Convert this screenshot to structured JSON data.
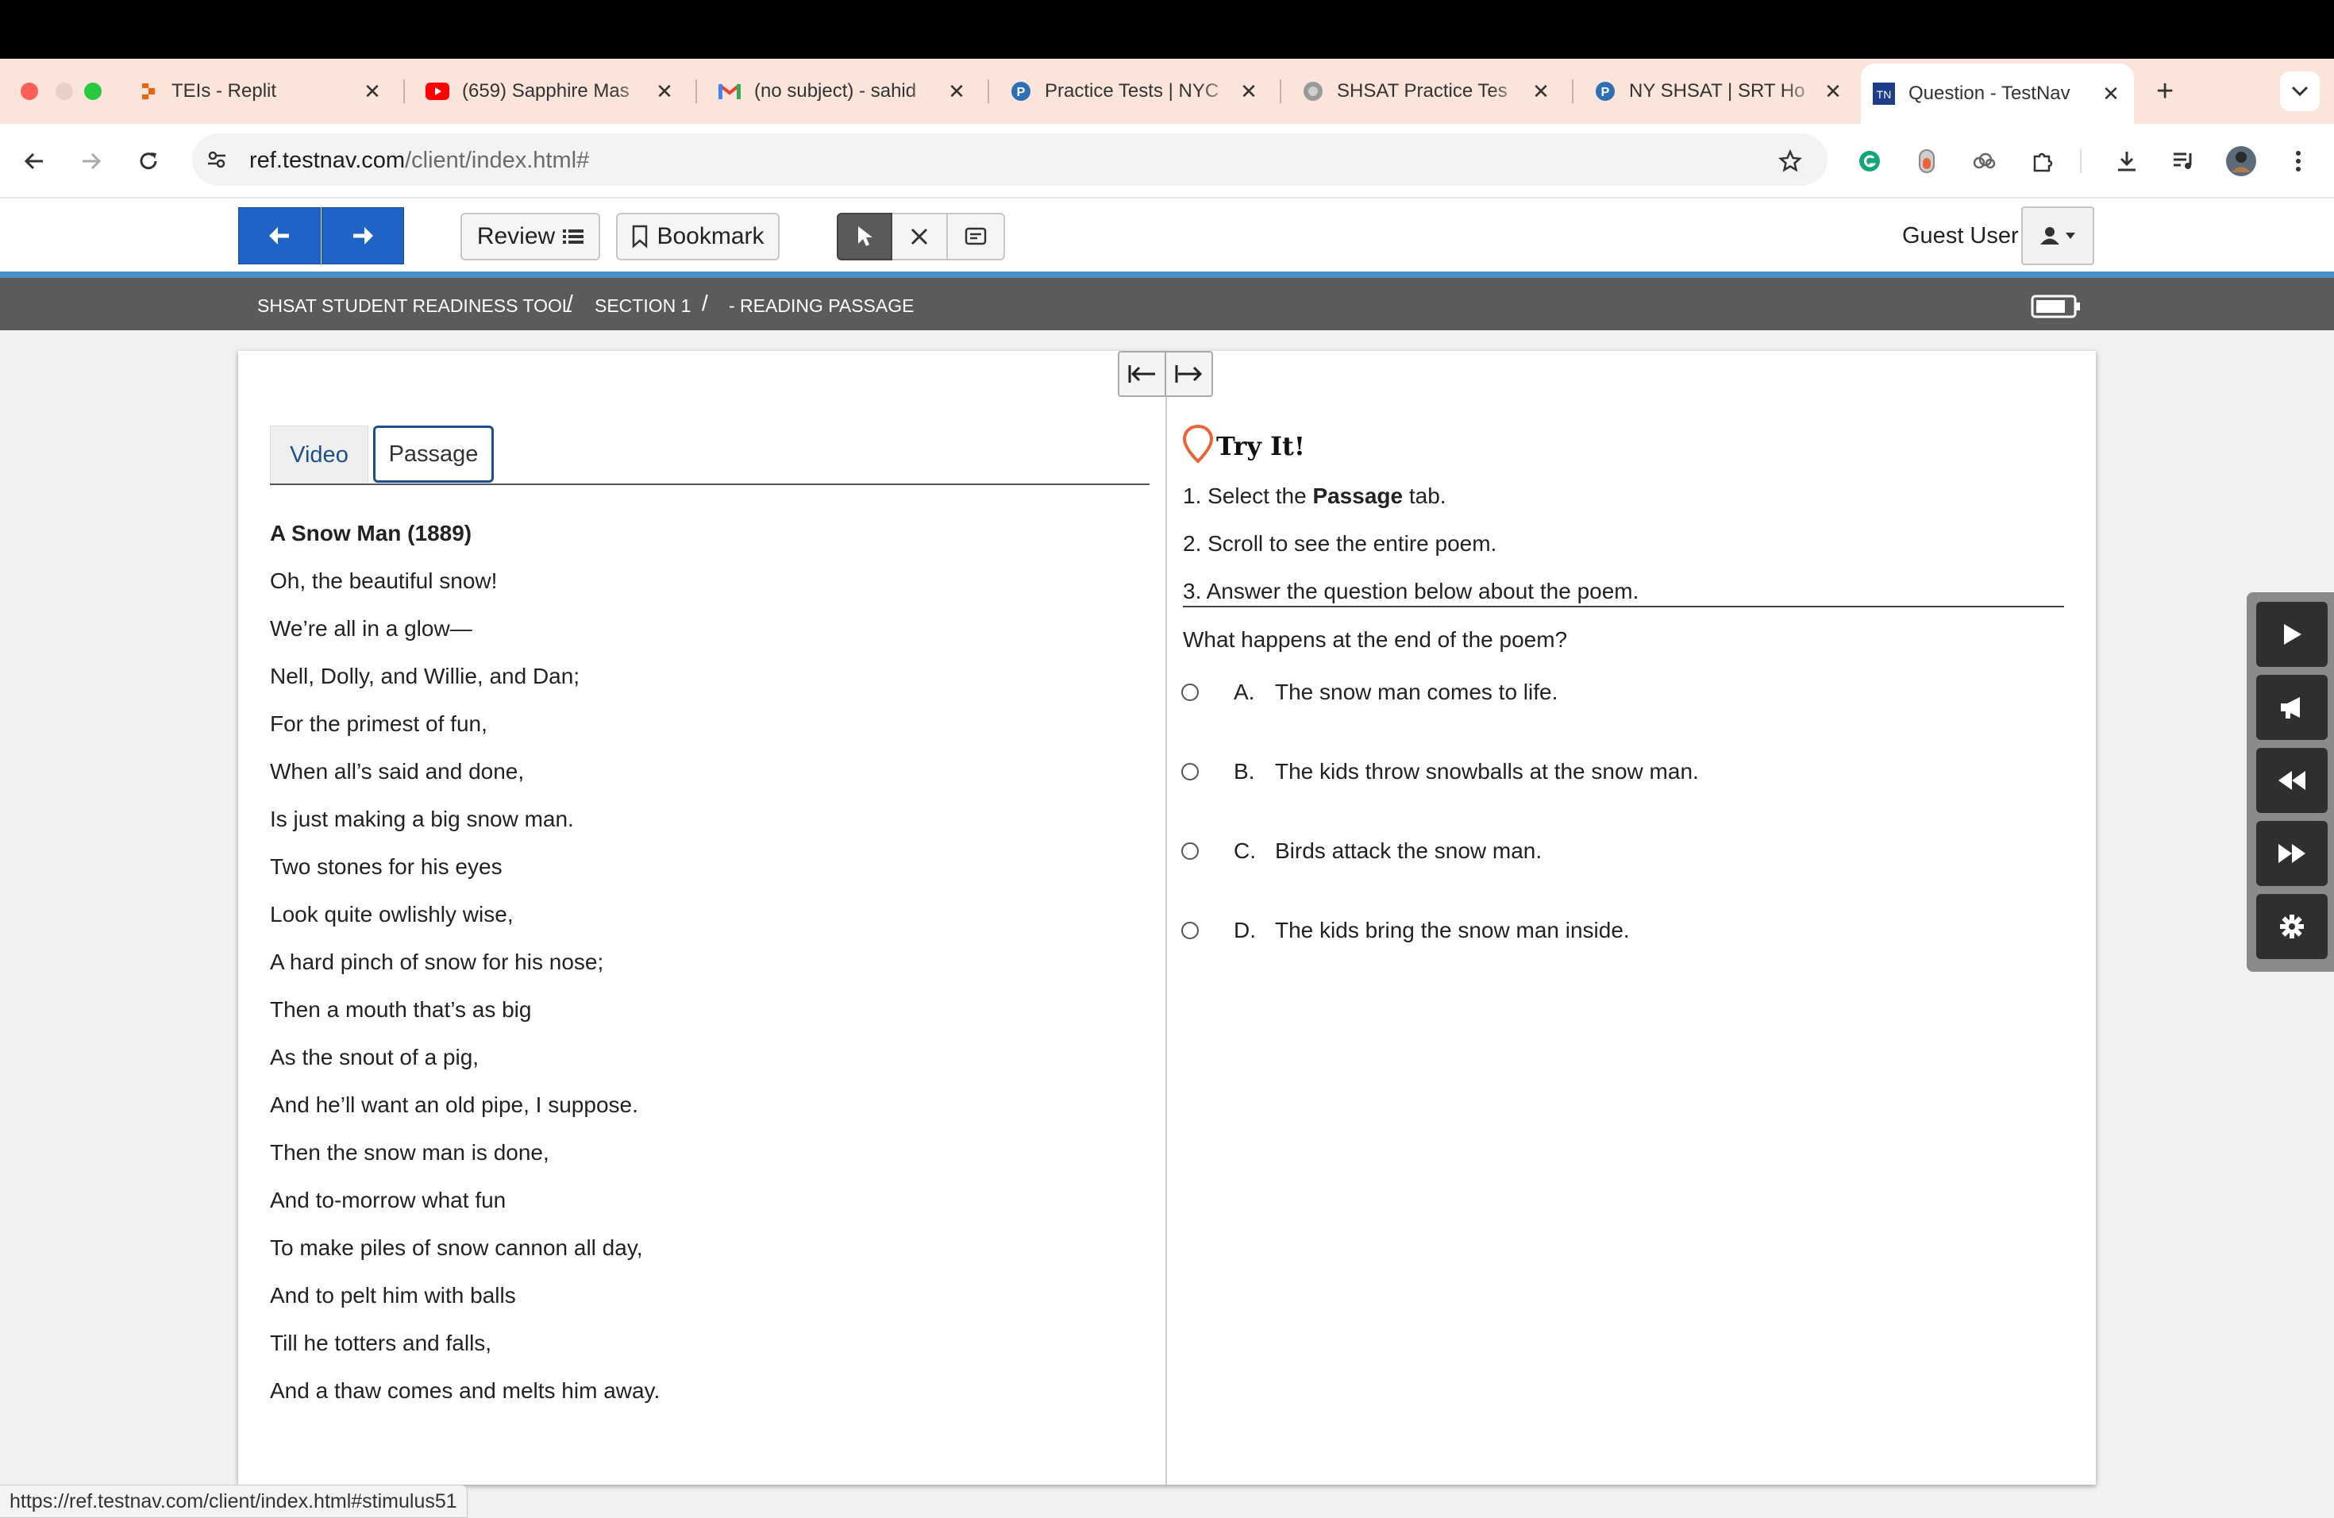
{
  "browser": {
    "tabs": [
      {
        "title": "TEIs - Replit",
        "favicon": "replit-icon",
        "active": false
      },
      {
        "title": "(659) Sapphire Mas",
        "favicon": "youtube-icon",
        "active": false
      },
      {
        "title": "(no subject) - sahid",
        "favicon": "gmail-icon",
        "active": false
      },
      {
        "title": "Practice Tests | NYC",
        "favicon": "p-circle-icon",
        "active": false
      },
      {
        "title": "SHSAT Practice Tes",
        "favicon": "globe-icon",
        "active": false
      },
      {
        "title": "NY SHSAT | SRT Ho",
        "favicon": "p-circle-icon",
        "active": false
      },
      {
        "title": "Question - TestNav",
        "favicon": "testnav-icon",
        "active": true
      }
    ],
    "new_tab_glyph": "+",
    "url_host": "ref.testnav.com",
    "url_path": "/client/index.html#",
    "status_url": "https://ref.testnav.com/client/index.html#stimulus51"
  },
  "app": {
    "review_label": "Review",
    "bookmark_label": "Bookmark",
    "guest_label": "Guest User",
    "breadcrumb": [
      "SHSAT STUDENT READINESS TOOL",
      "SECTION 1",
      "- READING PASSAGE"
    ],
    "breadcrumb_sep": "/"
  },
  "left_pane": {
    "tabs": {
      "video": "Video",
      "passage": "Passage"
    },
    "poem_title": "A Snow Man (1889)",
    "poem_lines": [
      "Oh, the beautiful snow!",
      "We’re all in a glow—",
      "Nell, Dolly, and Willie, and Dan;",
      "For the primest of fun,",
      "When all’s said and done,",
      "Is just making a big snow man.",
      "Two stones for his eyes",
      "Look quite owlishly wise,",
      "A hard pinch of snow for his nose;",
      "Then a mouth that’s as big",
      "As the snout of a pig,",
      "And he’ll want an old pipe, I suppose.",
      "Then the snow man is done,",
      "And to-morrow what fun",
      "To make piles of snow cannon all day,",
      "And to pelt him with balls",
      "Till he totters and falls,",
      "And a thaw comes and melts him away."
    ]
  },
  "right_pane": {
    "try_title": "Try It!",
    "instructions": {
      "step1_pre": "1. Select the ",
      "step1_bold": "Passage",
      "step1_post": " tab.",
      "step2": "2. Scroll to see the entire poem.",
      "step3": "3. Answer the question below about the poem."
    },
    "question": "What happens at the end of the poem?",
    "choices": [
      {
        "letter": "A.",
        "text": "The snow man comes to life."
      },
      {
        "letter": "B.",
        "text": "The kids throw snowballs at the snow man."
      },
      {
        "letter": "C.",
        "text": "Birds attack the snow man."
      },
      {
        "letter": "D.",
        "text": "The kids bring the snow man inside."
      }
    ]
  },
  "colors": {
    "tab_strip": "#fbe4d9",
    "nav_blue": "#1e63c5",
    "accent_line": "#4a90c8",
    "breadcrumb_bar": "#5b5b5b",
    "pin_orange": "#e8643a"
  }
}
